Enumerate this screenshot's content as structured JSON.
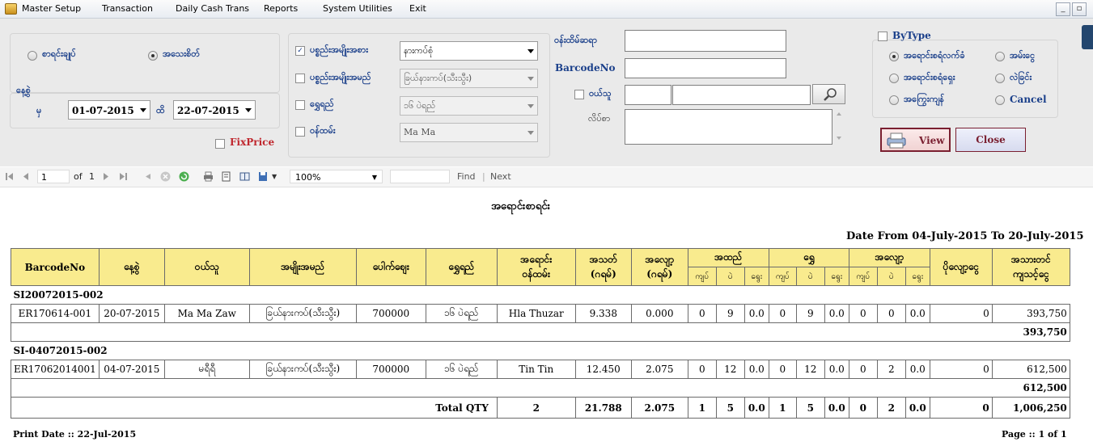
{
  "menu": [
    "Master Setup",
    "Transaction",
    "Daily Cash Trans",
    "Reports",
    "System Utilities",
    "Exit"
  ],
  "window_buttons": [
    "_",
    "▫"
  ],
  "filters": {
    "radio_list": "စာရင်းချုပ်",
    "radio_detail": "အသေးစိတ်",
    "date_label": "နေ့စွဲ",
    "from_label": "မှ",
    "from_date": "01-07-2015",
    "to_label": "ထိ",
    "to_date": "22-07-2015",
    "fix_price": "FixPrice",
    "item_type_label": "ပစ္စည်းအမျိုးအစား",
    "item_type_value": "နားကပ်စုံ",
    "item_name_label": "ပစ္စည်းအမျိုးအမည်",
    "item_name_value": "ခြယ်နားကပ်(သီးသွီး)",
    "gold_label": "ရွှေရည်",
    "gold_value": "၁၆ ပဲရည်",
    "staff_label": "ဝန်ထမ်း",
    "staff_value": "Ma Ma",
    "voucher_label": "ဝန်းထိမ်ဆရာ",
    "barcode_label": "BarcodeNo",
    "customer_label": "ဝယ်သူ",
    "address_label": "လိပ်စာ",
    "bytype_label": "ByType",
    "opt1": "အရောင်းစရံလက်ခံ",
    "opt2": "အမ်းငွေ",
    "opt3": "အရောင်းစရံရှေး",
    "opt4": "လဲခြင်း",
    "opt5": "အကြွေးကျန်",
    "opt6": "Cancel",
    "view_btn": "View",
    "close_btn": "Close"
  },
  "toolbar": {
    "page": "1",
    "of_label": "of",
    "total_pages": "1",
    "zoom": "100%",
    "find": "Find",
    "sep": "|",
    "next": "Next"
  },
  "report": {
    "title": "အရောင်းစာရင်း",
    "date_range": "Date From 04-July-2015  To 20-July-2015",
    "headers": {
      "barcode": "BarcodeNo",
      "date": "နေ့စွဲ",
      "customer": "ဝယ်သူ",
      "item_name": "အမျိုးအမည်",
      "price": "ပေါက်စျေး",
      "gold": "ရွှေရည်",
      "seller_1": "အရောင်း",
      "seller_2": "ဝန်ထမ်း",
      "net_wt_1": "အသတ်",
      "net_wt_2": "(ဂရမ်)",
      "loss_wt_1": "အလျော့",
      "loss_wt_2": "(ဂရမ်)",
      "grp_net": "အထည်",
      "grp_gold": "ရွှေ",
      "grp_loss": "အလျော့",
      "sub_k": "ကျပ်",
      "sub_p": "ပဲ",
      "sub_y": "ရွေး",
      "discount": "ပိုလျော့ငွေ",
      "total_1": "အသားတင်",
      "total_2": "ကျသင့်ငွေ"
    },
    "groups": [
      {
        "voucher": "SI20072015-002",
        "row": [
          "ER170614-001",
          "20-07-2015",
          "Ma Ma Zaw",
          "ခြယ်နားကပ်(သီးသွီး)",
          "700000",
          "၁၆ ပဲရည်",
          "Hla Thuzar",
          "9.338",
          "0.000",
          "0",
          "9",
          "0.0",
          "0",
          "9",
          "0.0",
          "0",
          "0",
          "0.0",
          "0",
          "393,750"
        ],
        "subtotal": "393,750"
      },
      {
        "voucher": "SI-04072015-002",
        "row": [
          "ER17062014001",
          "04-07-2015",
          "မရီရီ",
          "ခြယ်နားကပ်(သီးသွီး)",
          "700000",
          "၁၆ ပဲရည်",
          "Tin Tin",
          "12.450",
          "2.075",
          "0",
          "12",
          "0.0",
          "0",
          "12",
          "0.0",
          "0",
          "2",
          "0.0",
          "0",
          "612,500"
        ],
        "subtotal": "612,500"
      }
    ],
    "total_label": "Total QTY",
    "total_qty": "2",
    "total_vals": [
      "21.788",
      "2.075",
      "1",
      "5",
      "0.0",
      "1",
      "5",
      "0.0",
      "0",
      "2",
      "0.0",
      "0",
      "1,006,250"
    ],
    "print_date": "Print Date :: 22-Jul-2015",
    "page_info": "Page :: 1 of 1"
  }
}
